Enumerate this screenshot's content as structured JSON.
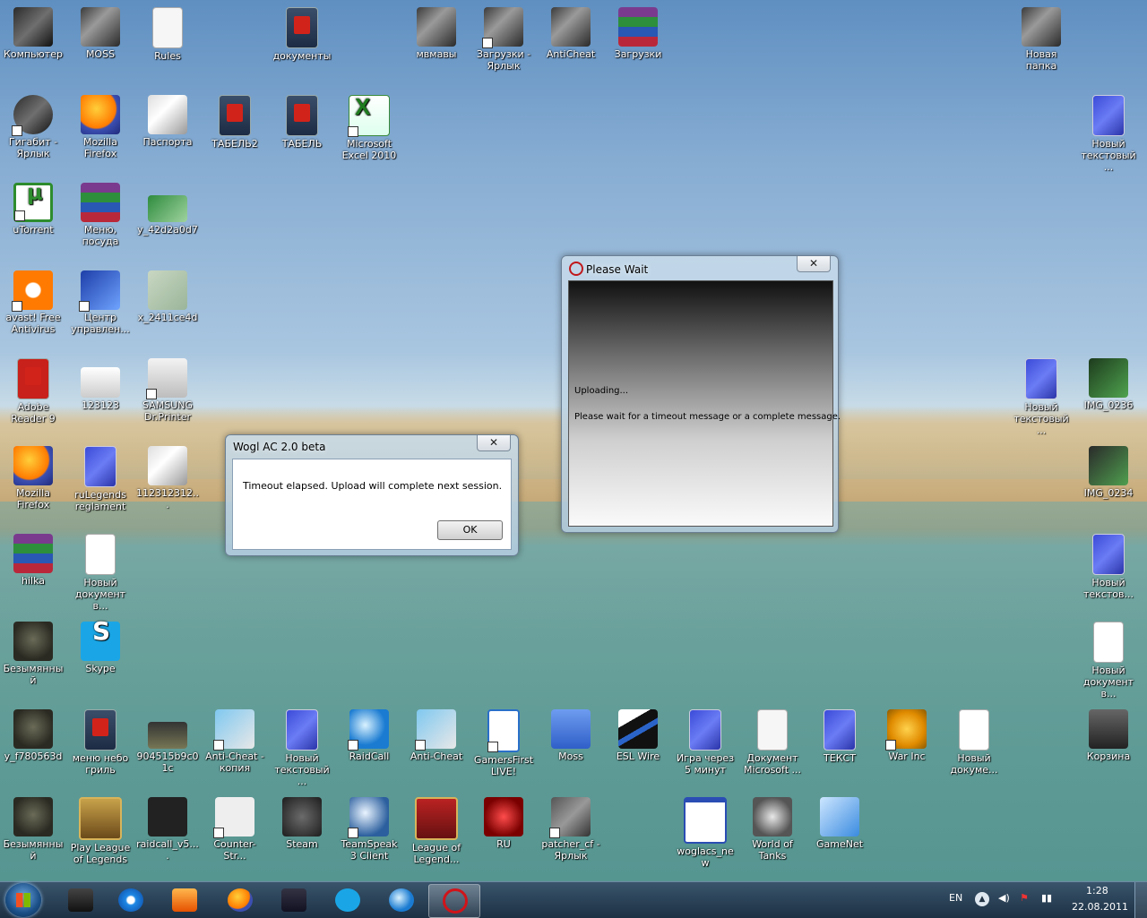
{
  "desktop_icons": {
    "computer": "Компьютер",
    "moss": "MOSS",
    "rules": "Rules",
    "documents": "документы",
    "mvmavy": "мвмавы",
    "downloads_shortcut": "Загрузки - Ярлык",
    "anticheat": "AntiCheat",
    "downloads": "Загрузки",
    "new_folder": "Новая папка",
    "gigabit": "Гигабит - Ярлык",
    "firefox1": "Mozilla Firefox",
    "passports": "Паспорта",
    "tabel2": "ТАБЕЛЬ2",
    "tabel": "ТАБЕЛЬ",
    "excel": "Microsoft Excel 2010",
    "new_text1": "Новый текстовый ...",
    "utorrent": "uTorrent",
    "menu": "Меню, посуда",
    "y42": "y_42d2a0d7",
    "avast": "avast! Free Antivirus",
    "center": "Центр управлен...",
    "x24": "x_2411ce4d",
    "adobe": "Adobe Reader 9",
    "n123123": "123123",
    "samsung": "SAMSUNG Dr.Printer",
    "new_text2": "Новый текстовый ...",
    "img0236": "IMG_0236",
    "firefox2": "Mozilla Firefox",
    "rulegends": "ruLegends reglament",
    "n112312312": "112312312...",
    "img0234": "IMG_0234",
    "hilka": "hilka",
    "new_doc1": "Новый документ в...",
    "new_text3": "Новый текстов...",
    "bezym1": "Безымянный",
    "skype": "Skype",
    "new_doc2": "Новый документ в...",
    "yf78": "y_f780563d",
    "menu_grill": "меню небо гриль",
    "n904515": "904515b9c01c",
    "anticheat_copy": "Anti-Cheat - копия",
    "new_text4": "Новый текстовый ...",
    "raidcall": "RaidCall",
    "anticheat2": "Anti-Cheat",
    "gamersfirst": "GamersFirst LIVE!",
    "moss2": "Moss",
    "eslwire": "ESL Wire",
    "igra": "Игра через 5 минут",
    "doc_ms": "Документ Microsoft ...",
    "tekst": "ТЕКСТ",
    "warinc": "War Inc",
    "new_doc3": "Новый докуме...",
    "trash": "Корзина",
    "bezym2": "Безымянный",
    "play_lol": "Play League of Legends",
    "raidcall_v5": "raidcall_v5....",
    "counterstrike": "Counter-Str...",
    "steam": "Steam",
    "teamspeak": "TeamSpeak 3 Client",
    "lol_legend": "League of Legend...",
    "ru": "RU",
    "patcher": "patcher_cf - Ярлык",
    "woglacs": "woglacs_new",
    "wot": "World of Tanks",
    "gamenet": "GameNet"
  },
  "dialog_wogl": {
    "title": "Wogl AC 2.0 beta",
    "close_label": "✕",
    "message": "Timeout elapsed. Upload will complete next session.",
    "ok_label": "OK"
  },
  "dialog_wait": {
    "title": "Please Wait",
    "close_label": "✕",
    "status": "Uploading...",
    "message": "Please wait for a timeout message or a complete message."
  },
  "taskbar": {
    "language": "EN",
    "time": "1:28",
    "date": "22.08.2011"
  },
  "colors": {
    "taskbar": "#1e3a52",
    "dialog_frame": "#b4cde1",
    "pdf_red": "#d2231a"
  }
}
